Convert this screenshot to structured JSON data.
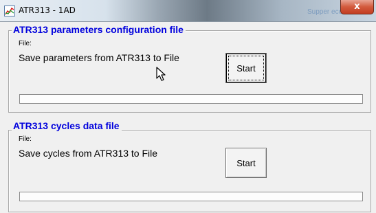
{
  "window": {
    "title": "ATR313 - 1AD",
    "background_title": "Supper ecce",
    "close_label": "x"
  },
  "parameters_group": {
    "legend": "ATR313 parameters configuration file",
    "file_label": "File:",
    "description": "Save parameters from ATR313 to File",
    "start_label": "Start",
    "progress": 0
  },
  "cycles_group": {
    "legend": "ATR313 cycles data file",
    "file_label": "File:",
    "description": "Save cycles from ATR313 to File",
    "start_label": "Start",
    "progress": 0
  },
  "colors": {
    "legend_text": "#0000dd",
    "dialog_background": "#f0f0f0",
    "close_button": "#c94a2f"
  },
  "icons": [
    "app-chart-icon",
    "close-icon",
    "mouse-pointer-icon"
  ]
}
